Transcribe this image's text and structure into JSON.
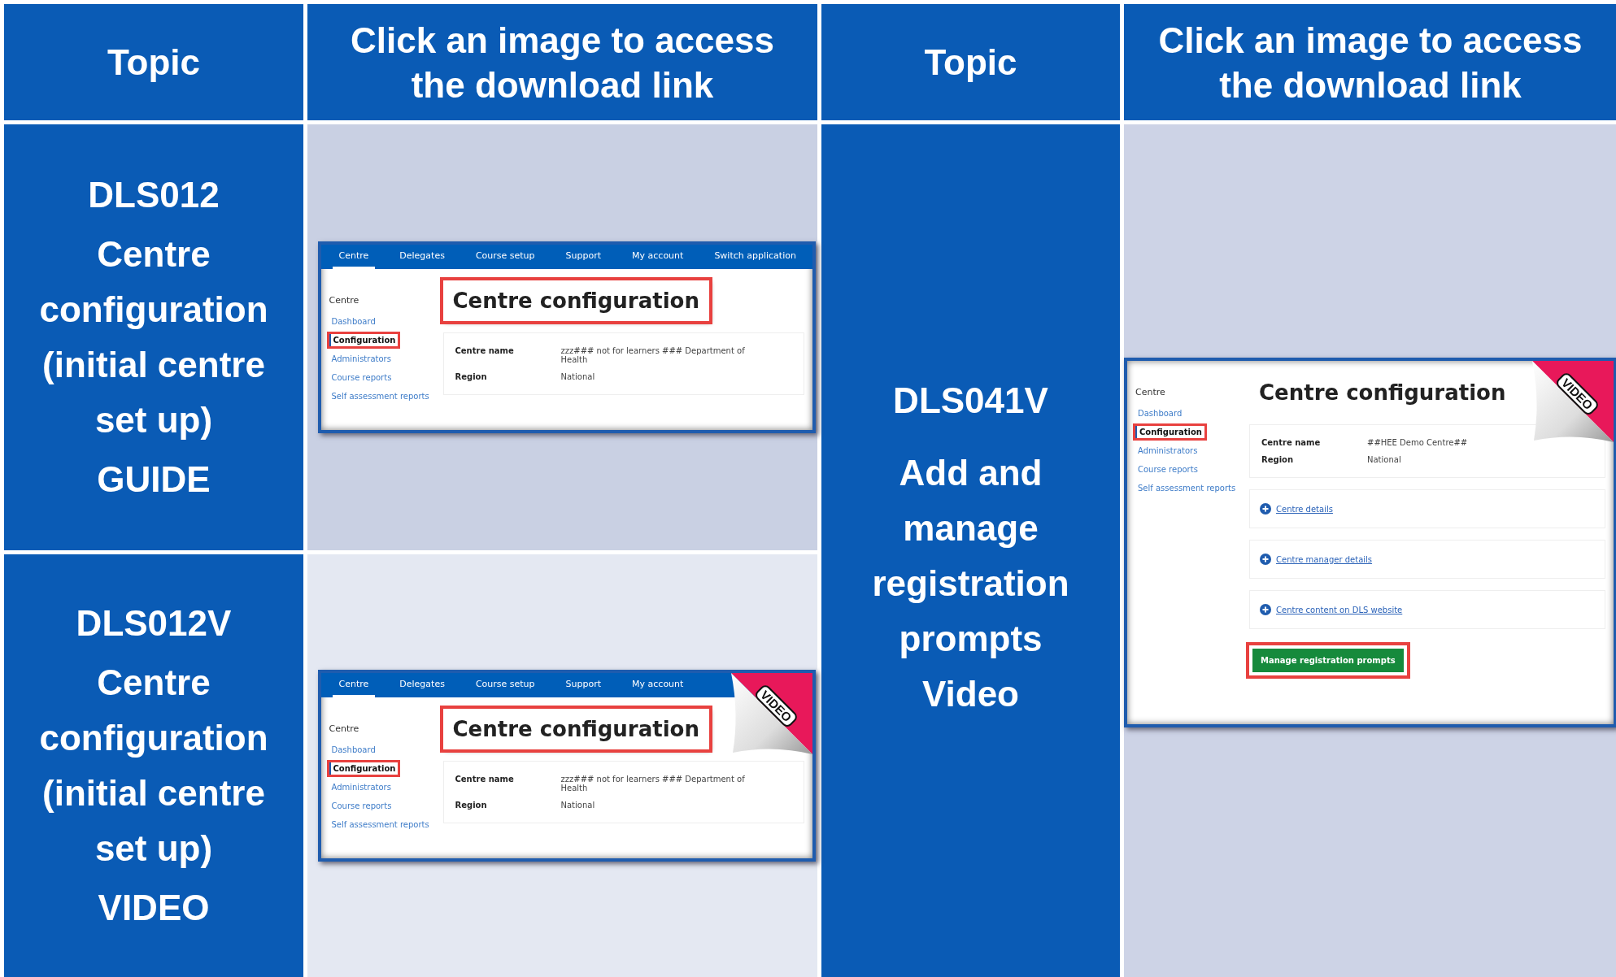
{
  "header": [
    "Topic",
    "Click an image to access the download link",
    "Topic",
    "Click an image to access the download link"
  ],
  "rows": [
    {
      "code": "DLS012",
      "title": "Centre configuration (initial centre set up)",
      "format": "GUIDE",
      "screenshot": {
        "nav": [
          {
            "label": "Centre",
            "selected": true
          },
          {
            "label": "Delegates",
            "selected": false
          },
          {
            "label": "Course setup",
            "selected": false
          },
          {
            "label": "Support",
            "selected": false
          },
          {
            "label": "My account",
            "selected": false
          },
          {
            "label": "Switch application",
            "selected": false
          }
        ],
        "sidebar_title": "Centre",
        "sidebar": [
          {
            "label": "Dashboard",
            "selected": false
          },
          {
            "label": "Configuration",
            "selected": true
          },
          {
            "label": "Administrators",
            "selected": false
          },
          {
            "label": "Course reports",
            "selected": false
          },
          {
            "label": "Self assessment reports",
            "selected": false
          }
        ],
        "heading": {
          "text": "Centre configuration",
          "highlighted": true
        },
        "fields": [
          {
            "label": "Centre name",
            "value": "zzz### not for learners ### Department of Health"
          },
          {
            "label": "Region",
            "value": "National"
          }
        ]
      }
    },
    {
      "code": "DLS012V",
      "title": "Centre configuration (initial centre set up)",
      "format": "VIDEO",
      "screenshot": {
        "nav": [
          {
            "label": "Centre",
            "selected": true
          },
          {
            "label": "Delegates",
            "selected": false
          },
          {
            "label": "Course setup",
            "selected": false
          },
          {
            "label": "Support",
            "selected": false
          },
          {
            "label": "My account",
            "selected": false
          }
        ],
        "sidebar_title": "Centre",
        "sidebar": [
          {
            "label": "Dashboard",
            "selected": false
          },
          {
            "label": "Configuration",
            "selected": true
          },
          {
            "label": "Administrators",
            "selected": false
          },
          {
            "label": "Course reports",
            "selected": false
          },
          {
            "label": "Self assessment reports",
            "selected": false
          }
        ],
        "heading": {
          "text": "Centre configuration",
          "highlighted": true
        },
        "fields": [
          {
            "label": "Centre name",
            "value": "zzz### not for learners ### Department of Health"
          },
          {
            "label": "Region",
            "value": "National"
          }
        ],
        "badge": "VIDEO"
      }
    },
    {
      "code": "DLS041V",
      "title": "Add and manage registration prompts",
      "format": "Video",
      "screenshot": {
        "sidebar_title": "Centre",
        "sidebar": [
          {
            "label": "Dashboard",
            "selected": false
          },
          {
            "label": "Configuration",
            "selected": true
          },
          {
            "label": "Administrators",
            "selected": false
          },
          {
            "label": "Course reports",
            "selected": false
          },
          {
            "label": "Self assessment reports",
            "selected": false
          }
        ],
        "heading": {
          "text": "Centre configuration",
          "highlighted": false
        },
        "fields": [
          {
            "label": "Centre name",
            "value": "##HEE Demo Centre##"
          },
          {
            "label": "Region",
            "value": "National"
          }
        ],
        "links": [
          "Centre details",
          "Centre manager details",
          "Centre content on DLS website"
        ],
        "button": {
          "label": "Manage registration prompts",
          "highlighted": true
        },
        "badge": "VIDEO"
      }
    }
  ]
}
